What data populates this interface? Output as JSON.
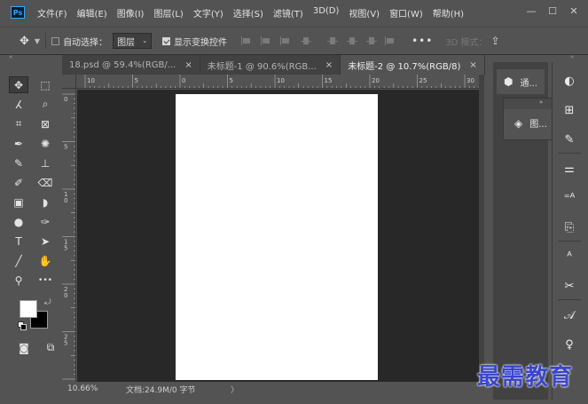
{
  "app": {
    "logo": "Ps",
    "accent": "#31a8ff"
  },
  "menu": [
    "文件(F)",
    "编辑(E)",
    "图像(I)",
    "图层(L)",
    "文字(Y)",
    "选择(S)",
    "滤镜(T)",
    "3D(D)",
    "视图(V)",
    "窗口(W)",
    "帮助(H)"
  ],
  "window_controls": {
    "minimize": "—",
    "maximize": "☐",
    "close": "✕"
  },
  "options": {
    "move_icon": "move-tool-icon",
    "auto_select_label": "自动选择：",
    "auto_select_checked": false,
    "layer_select_value": "图层",
    "show_transform_label": "显示变换控件",
    "show_transform_checked": true,
    "more_label": "•••",
    "mode_3d_label": "3D 模式：",
    "share_icon": "share-icon"
  },
  "tabs": [
    {
      "label": "18.psd @ 59.4%(RGB/...",
      "close": "×",
      "active": false
    },
    {
      "label": "未标题-1 @ 90.6%(RGB...",
      "close": "×",
      "active": false
    },
    {
      "label": "未标题-2 @ 10.7%(RGB/8)",
      "close": "×",
      "active": true
    }
  ],
  "rulers": {
    "horizontal_labels": [
      "10",
      "5",
      "0",
      "5",
      "10",
      "15",
      "20",
      "25",
      "30"
    ],
    "vertical_labels": [
      "0",
      "5",
      "1\n0",
      "1\n5",
      "2\n0",
      "2\n5"
    ]
  },
  "status": {
    "zoom": "10.66%",
    "doc_info": "文档:24.9M/0 字节",
    "arrow": "〉"
  },
  "tools": [
    {
      "name": "move-tool",
      "glyph": "✥",
      "active": true
    },
    {
      "name": "marquee-tool",
      "glyph": "⬚",
      "active": false
    },
    {
      "name": "lasso-tool",
      "glyph": "ⵃ",
      "active": false
    },
    {
      "name": "quick-select-tool",
      "glyph": "⌕",
      "active": false
    },
    {
      "name": "crop-tool",
      "glyph": "⌗",
      "active": false
    },
    {
      "name": "frame-tool",
      "glyph": "⊠",
      "active": false
    },
    {
      "name": "eyedropper-tool",
      "glyph": "✒",
      "active": false
    },
    {
      "name": "patch-tool",
      "glyph": "✺",
      "active": false
    },
    {
      "name": "brush-tool",
      "glyph": "✎",
      "active": false
    },
    {
      "name": "stamp-tool",
      "glyph": "⊥",
      "active": false
    },
    {
      "name": "history-brush-tool",
      "glyph": "✐",
      "active": false
    },
    {
      "name": "eraser-tool",
      "glyph": "⌫",
      "active": false
    },
    {
      "name": "gradient-tool",
      "glyph": "▣",
      "active": false
    },
    {
      "name": "blur-tool",
      "glyph": "◗",
      "active": false
    },
    {
      "name": "dodge-tool",
      "glyph": "●",
      "active": false
    },
    {
      "name": "pen-tool",
      "glyph": "✑",
      "active": false
    },
    {
      "name": "type-tool",
      "glyph": "T",
      "active": false
    },
    {
      "name": "path-select-tool",
      "glyph": "➤",
      "active": false
    },
    {
      "name": "line-tool",
      "glyph": "╱",
      "active": false
    },
    {
      "name": "hand-tool",
      "glyph": "✋",
      "active": false
    },
    {
      "name": "zoom-tool",
      "glyph": "⚲",
      "active": false
    },
    {
      "name": "more-tools",
      "glyph": "•••",
      "active": false
    }
  ],
  "colors": {
    "foreground": "#ffffff",
    "background": "#000000"
  },
  "toolbar_bottom": [
    {
      "name": "quick-mask-button",
      "glyph": "◙"
    },
    {
      "name": "screen-mode-button",
      "glyph": "⧉"
    }
  ],
  "dock": {
    "channels_tab_label": "通...",
    "layers_tab_label": "图...",
    "icons": [
      "color-icon",
      "swatches-icon",
      "brush-settings-icon",
      "adjustments-icon",
      "character-style-icon",
      "clone-source-icon",
      "paragraph-icon",
      "tool-presets-icon",
      "glyphs-icon",
      "learn-icon"
    ]
  },
  "watermark": "最需教育"
}
